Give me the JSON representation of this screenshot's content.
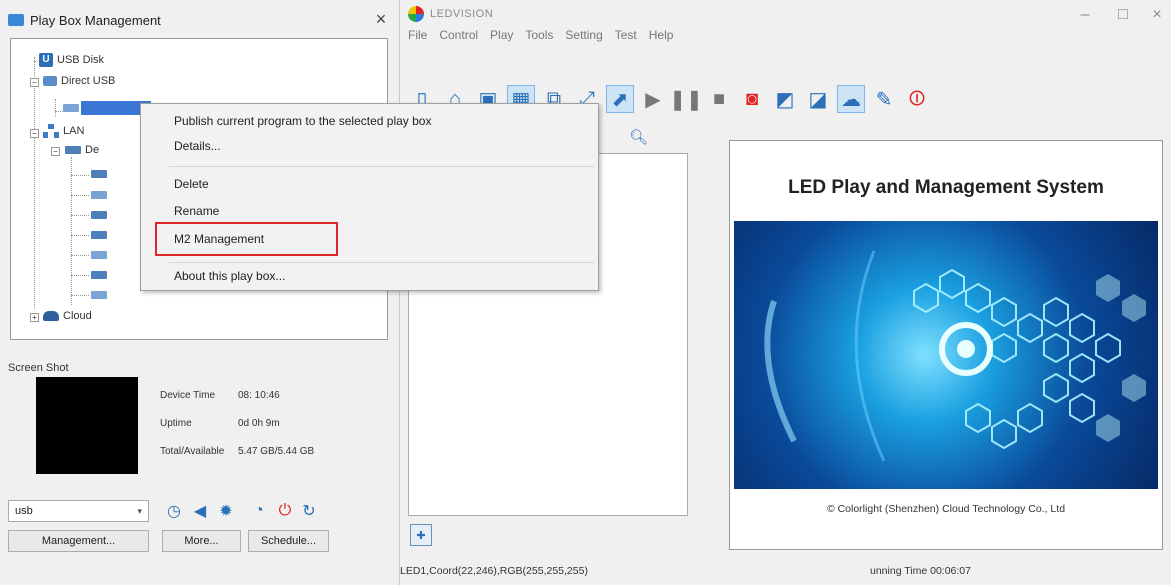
{
  "left_panel": {
    "title": "Play Box Management",
    "close_glyph": "×",
    "tree": {
      "usb_disk": "USB Disk",
      "direct_usb": "Direct USB",
      "lan": "LAN",
      "lan_child": "De",
      "cloud": "Cloud"
    },
    "screenshot_label": "Screen Shot",
    "info": [
      {
        "key": "Device Time",
        "value": "08: 10:46"
      },
      {
        "key": "Uptime",
        "value": "0d 0h 9m"
      },
      {
        "key": "Total/Available",
        "value": "5.47 GB/5.44 GB"
      }
    ],
    "device_select": "usb",
    "buttons": {
      "management": "Management...",
      "more": "More...",
      "schedule": "Schedule..."
    },
    "control_icons": [
      "clock-icon",
      "volume-icon",
      "brightness-icon",
      "power-timer-icon",
      "power-icon",
      "restart-icon"
    ]
  },
  "context_menu": {
    "items": [
      "Publish current program to the selected play box",
      "Details...",
      "Delete",
      "Rename",
      "M2 Management",
      "About this play box..."
    ],
    "highlight_color": "#e0252b"
  },
  "app": {
    "title": "LEDVISION",
    "menu": [
      "File",
      "Control",
      "Play",
      "Tools",
      "Setting",
      "Test",
      "Help"
    ],
    "win_controls": {
      "minimize": "–",
      "maximize": "□",
      "close": "×"
    },
    "toolbar_icons": [
      "new-icon",
      "open-icon",
      "save-icon",
      "screen-icon",
      "window-icon",
      "edit-icon",
      "select-icon",
      "play-icon",
      "pause-icon",
      "stop-icon",
      "record-icon",
      "screen-settings-icon",
      "screen-check-icon",
      "cloud-screen-icon",
      "tools-icon",
      "power-off-icon"
    ],
    "splash": {
      "title": "LED Play and Management System",
      "footer": "© Colorlight (Shenzhen) Cloud Technology Co., Ltd"
    },
    "status": {
      "left": "LED1,Coord(22,246),RGB(255,255,255)",
      "right": "unning Time 00:06:07"
    }
  },
  "colors": {
    "selection": "#3a77d4",
    "accent_blue": "#2a6fb8",
    "accent_red": "#e02424"
  }
}
